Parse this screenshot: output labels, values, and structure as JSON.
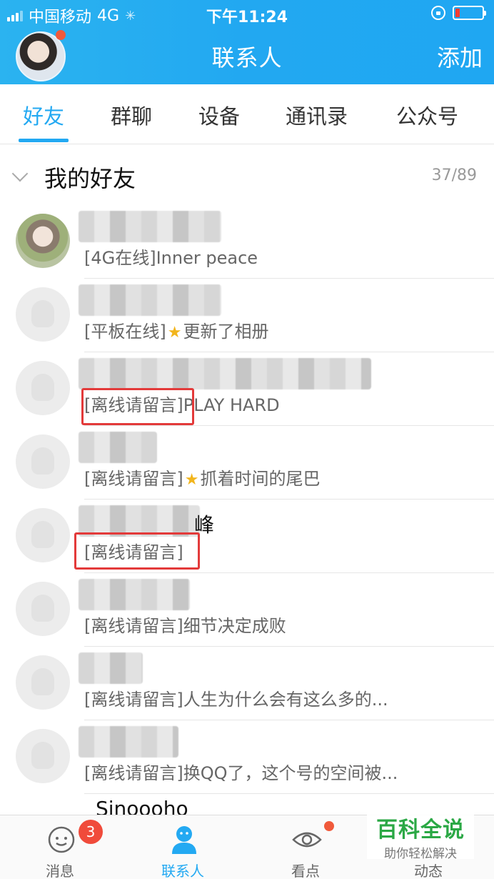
{
  "status_bar": {
    "carrier": "中国移动",
    "network": "4G",
    "time": "下午11:24"
  },
  "header": {
    "title": "联系人",
    "add_label": "添加"
  },
  "tabs": [
    {
      "label": "好友",
      "active": true
    },
    {
      "label": "群聊"
    },
    {
      "label": "设备"
    },
    {
      "label": "通讯录"
    },
    {
      "label": "公众号"
    }
  ],
  "group": {
    "title": "我的好友",
    "count": "37/89"
  },
  "friends": [
    {
      "name_visible": "",
      "status_prefix": "[4G在线]",
      "status_text": "Inner peace"
    },
    {
      "name_visible": "",
      "status_prefix": "[平板在线]",
      "status_text": "更新了相册"
    },
    {
      "name_visible": "",
      "status_prefix": "[离线请留言]",
      "status_text": "PLAY HARD"
    },
    {
      "name_visible": "",
      "status_prefix": "[离线请留言]",
      "status_text": "抓着时间的尾巴"
    },
    {
      "name_visible": "峰",
      "status_prefix": "[离线请留言]",
      "status_text": ""
    },
    {
      "name_visible": "",
      "status_prefix": "[离线请留言]",
      "status_text": "细节决定成败"
    },
    {
      "name_visible": "",
      "status_prefix": "[离线请留言]",
      "status_text": "人生为什么会有这么多的..."
    },
    {
      "name_visible": "",
      "status_prefix": "[离线请留言]",
      "status_text": "换QQ了，这个号的空间被..."
    },
    {
      "name_visible": "Sinoooho",
      "status_prefix": "",
      "status_text": ""
    }
  ],
  "tabbar": [
    {
      "label": "消息",
      "badge": "3"
    },
    {
      "label": "联系人",
      "active": true
    },
    {
      "label": "看点"
    },
    {
      "label": "动态"
    }
  ],
  "watermark": {
    "title": "百科全说",
    "subtitle": "助你轻松解决"
  },
  "colors": {
    "accent": "#23a9f2",
    "highlight": "#e33a3a",
    "badge": "#f04b3b"
  }
}
